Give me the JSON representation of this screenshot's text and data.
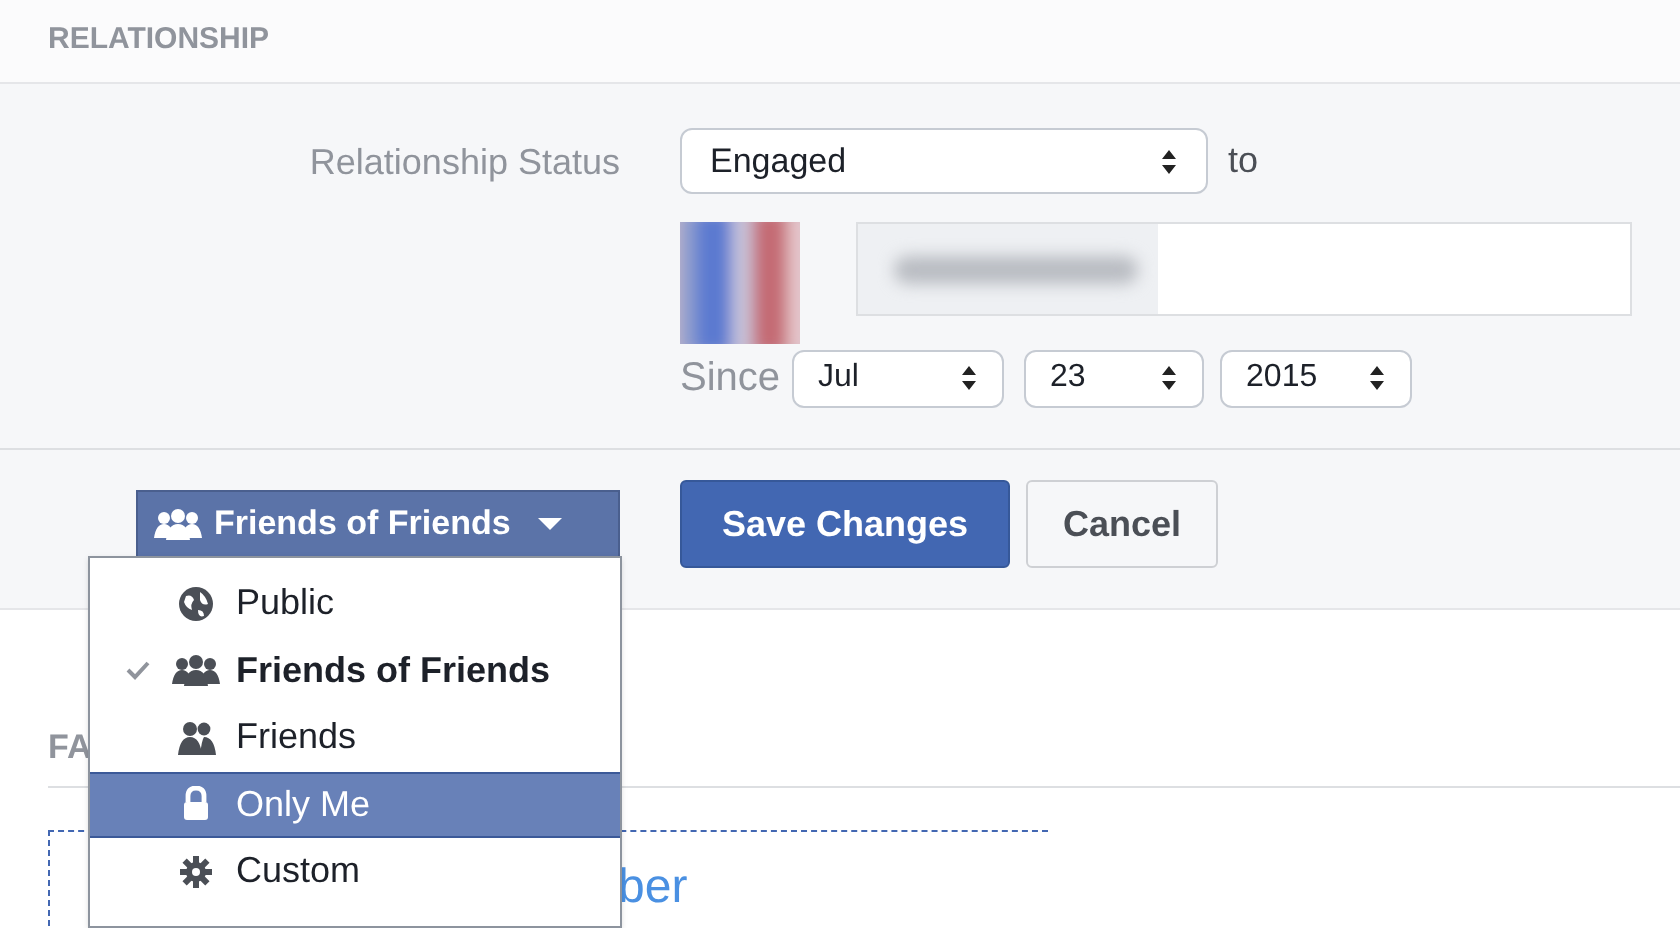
{
  "section": {
    "title": "RELATIONSHIP"
  },
  "status": {
    "label": "Relationship Status",
    "value": "Engaged",
    "connector": "to"
  },
  "since": {
    "label": "Since",
    "month": "Jul",
    "day": "23",
    "year": "2015"
  },
  "privacy": {
    "label": "Friends of Friends",
    "expanded": true
  },
  "buttons": [
    {
      "label": "Save Changes",
      "kind": "primary"
    },
    {
      "label": "Cancel",
      "kind": "secondary"
    }
  ],
  "privacy_menu": [
    {
      "label": "Public",
      "kind": "globe",
      "checked": false,
      "selected": false
    },
    {
      "label": "Friends of Friends",
      "kind": "group",
      "checked": true,
      "selected": false
    },
    {
      "label": "Friends",
      "kind": "pair",
      "checked": false,
      "selected": false
    },
    {
      "label": "Only Me",
      "kind": "lock",
      "checked": false,
      "selected": true
    },
    {
      "label": "Custom",
      "kind": "gear",
      "checked": false,
      "selected": false
    }
  ],
  "next_section": {
    "title": "FA",
    "link": "ber"
  }
}
